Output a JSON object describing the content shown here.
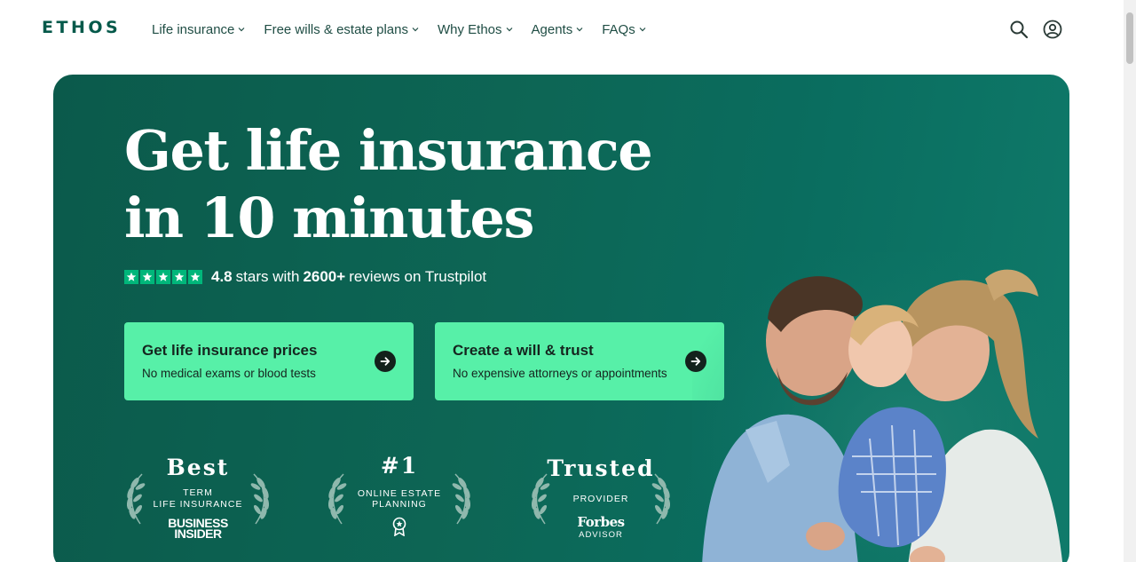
{
  "header": {
    "logo": "ETHOS",
    "nav": [
      {
        "label": "Life insurance"
      },
      {
        "label": "Free wills & estate plans"
      },
      {
        "label": "Why Ethos"
      },
      {
        "label": "Agents"
      },
      {
        "label": "FAQs"
      }
    ],
    "icons": [
      "search-icon",
      "account-icon"
    ]
  },
  "hero": {
    "title_line1": "Get life insurance",
    "title_line2": "in 10 minutes",
    "rating": {
      "stars": 5,
      "score": "4.8",
      "text_mid": "stars with",
      "count": "2600+",
      "text_end": "reviews on Trustpilot"
    },
    "cta": [
      {
        "title": "Get life insurance prices",
        "subtitle": "No medical exams or blood tests"
      },
      {
        "title": "Create a will & trust",
        "subtitle": "No expensive attorneys or appointments"
      }
    ],
    "awards": [
      {
        "head": "Best",
        "line1": "TERM",
        "line2": "LIFE INSURANCE",
        "brand1": "BUSINESS",
        "brand2": "INSIDER"
      },
      {
        "head": "#1",
        "line1": "ONLINE ESTATE",
        "line2": "PLANNING",
        "icon": "award-ribbon-icon"
      },
      {
        "head": "Trusted",
        "line1": "PROVIDER",
        "brand1": "Forbes",
        "brand2": "ADVISOR"
      }
    ]
  },
  "colors": {
    "brand": "#05594a",
    "hero_bg": "#0b5a4b",
    "cta_bg": "#57f0a8",
    "trustpilot": "#00b67a"
  }
}
